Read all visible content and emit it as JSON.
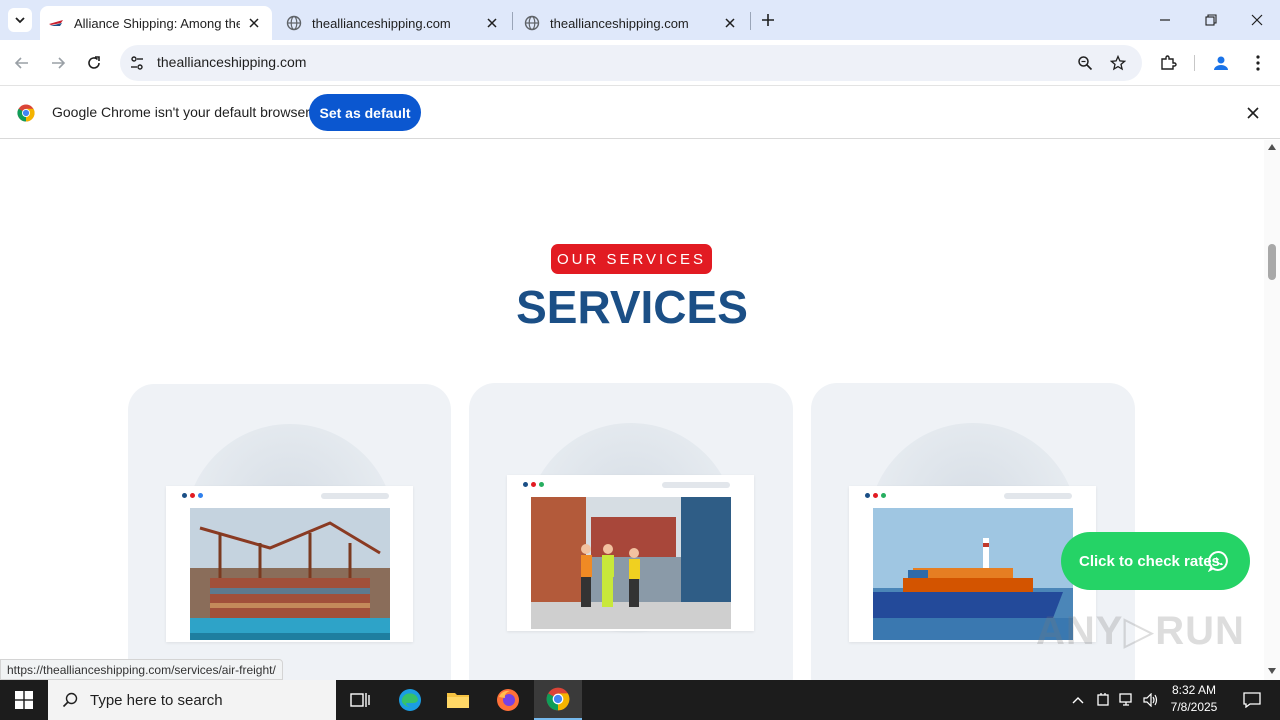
{
  "tabs": [
    {
      "title": "Alliance Shipping: Among the T",
      "active": true
    },
    {
      "title": "thealliance shipping.com",
      "active": false
    },
    {
      "title": "thealliance shipping.com",
      "active": false
    }
  ],
  "tabs_fixed": [
    "thealliance shipping.com"
  ],
  "toolbar": {
    "url": "thealliance shipping.com"
  },
  "infobar": {
    "message": "Google Chrome isn't your default browser",
    "button": "Set as default"
  },
  "page": {
    "badge": "OUR SERVICES",
    "heading": "SERVICES",
    "whatsapp_button": "Click to check rates",
    "status_url": "https://thealliance shipping.com/services/air-freight/",
    "watermark": "ANY RUN"
  },
  "taskbar": {
    "search_placeholder": "Type here to search",
    "time": "8:32 AM",
    "date": "7/8/2025"
  },
  "colors": {
    "accent": "#0b57d0",
    "badge": "#e21b22",
    "heading": "#1b4f86",
    "whatsapp": "#25d366"
  }
}
